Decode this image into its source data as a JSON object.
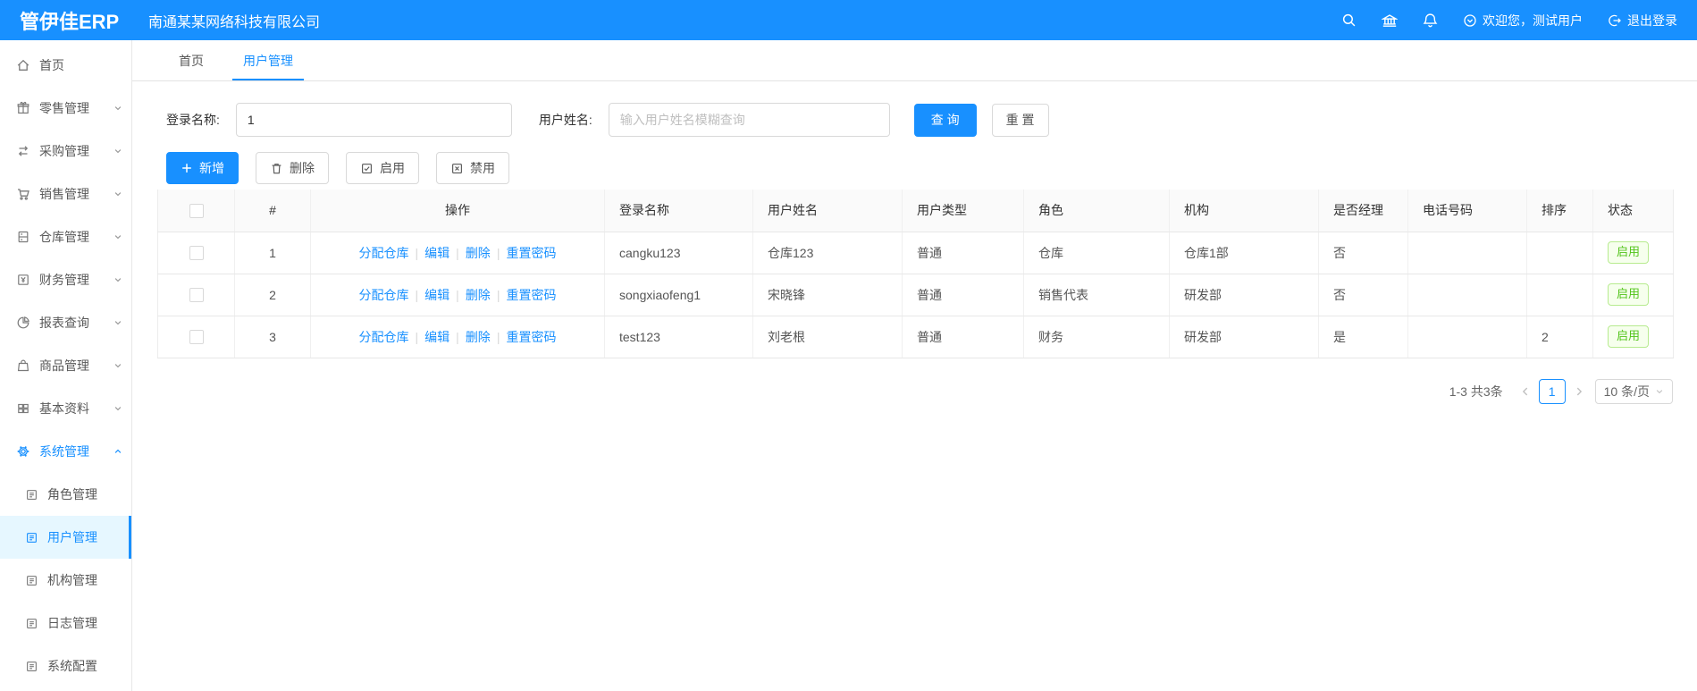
{
  "header": {
    "logo": "管伊佳ERP",
    "company": "南通某某网络科技有限公司",
    "welcome": "欢迎您，测试用户",
    "logout": "退出登录"
  },
  "sidebar": {
    "items": [
      {
        "label": "首页",
        "icon": "home",
        "chevron": ""
      },
      {
        "label": "零售管理",
        "icon": "gift",
        "chevron": "down"
      },
      {
        "label": "采购管理",
        "icon": "swap",
        "chevron": "down"
      },
      {
        "label": "销售管理",
        "icon": "cart",
        "chevron": "down"
      },
      {
        "label": "仓库管理",
        "icon": "warehouse",
        "chevron": "down"
      },
      {
        "label": "财务管理",
        "icon": "finance",
        "chevron": "down"
      },
      {
        "label": "报表查询",
        "icon": "pie-chart",
        "chevron": "down"
      },
      {
        "label": "商品管理",
        "icon": "shopping-bag",
        "chevron": "down"
      },
      {
        "label": "基本资料",
        "icon": "grid",
        "chevron": "down"
      },
      {
        "label": "系统管理",
        "icon": "gear",
        "chevron": "up",
        "active": true
      }
    ],
    "subitems": [
      {
        "label": "角色管理",
        "active": false
      },
      {
        "label": "用户管理",
        "active": true
      },
      {
        "label": "机构管理",
        "active": false
      },
      {
        "label": "日志管理",
        "active": false
      },
      {
        "label": "系统配置",
        "active": false
      }
    ]
  },
  "tabs": [
    {
      "label": "首页",
      "active": false
    },
    {
      "label": "用户管理",
      "active": true
    }
  ],
  "filters": {
    "login_label": "登录名称:",
    "login_value": "1",
    "name_label": "用户姓名:",
    "name_placeholder": "输入用户姓名模糊查询",
    "search_button": "查 询",
    "reset_button": "重 置"
  },
  "toolbar": {
    "add": "新增",
    "delete": "删除",
    "enable": "启用",
    "disable": "禁用"
  },
  "table": {
    "columns": [
      "#",
      "操作",
      "登录名称",
      "用户姓名",
      "用户类型",
      "角色",
      "机构",
      "是否经理",
      "电话号码",
      "排序",
      "状态"
    ],
    "action_links": [
      "分配仓库",
      "编辑",
      "删除",
      "重置密码"
    ],
    "rows": [
      {
        "index": "1",
        "login": "cangku123",
        "name": "仓库123",
        "type": "普通",
        "role": "仓库",
        "org": "仓库1部",
        "manager": "否",
        "phone": "",
        "sort": "",
        "status": "启用"
      },
      {
        "index": "2",
        "login": "songxiaofeng1",
        "name": "宋晓锋",
        "type": "普通",
        "role": "销售代表",
        "org": "研发部",
        "manager": "否",
        "phone": "",
        "sort": "",
        "status": "启用"
      },
      {
        "index": "3",
        "login": "test123",
        "name": "刘老根",
        "type": "普通",
        "role": "财务",
        "org": "研发部",
        "manager": "是",
        "phone": "",
        "sort": "2",
        "status": "启用"
      }
    ]
  },
  "pagination": {
    "total": "1-3 共3条",
    "page": "1",
    "page_size": "10 条/页"
  },
  "colors": {
    "primary": "#1890ff",
    "success_text": "#52c41a",
    "success_border": "#b7eb8f",
    "success_bg": "#f6ffed"
  }
}
